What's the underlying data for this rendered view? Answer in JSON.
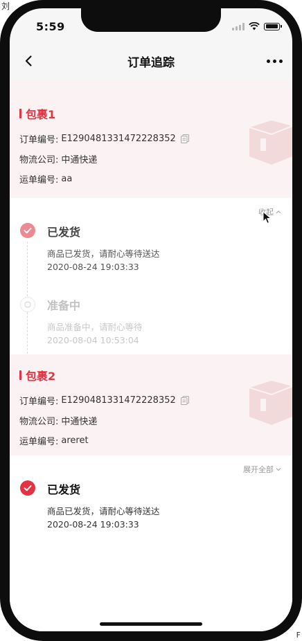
{
  "corner": {
    "top_left": "刘",
    "bottom_right": "F"
  },
  "status_bar": {
    "time": "5:59"
  },
  "nav": {
    "title": "订单追踪"
  },
  "packages": [
    {
      "title": "包裹1",
      "order_label": "订单编号:",
      "order_no": "E1290481331472228352",
      "carrier_label": "物流公司:",
      "carrier": "中通快递",
      "waybill_label": "运单编号:",
      "waybill": "aa",
      "toggle_label": "收起",
      "events": [
        {
          "status": "已发货",
          "desc": "商品已发货，请耐心等待送达",
          "time": "2020-08-24 19:03:33"
        },
        {
          "status": "准备中",
          "desc": "商品准备中，请耐心等待",
          "time": "2020-08-04 10:53:04"
        }
      ]
    },
    {
      "title": "包裹2",
      "order_label": "订单编号:",
      "order_no": "E1290481331472228352",
      "carrier_label": "物流公司:",
      "carrier": "中通快递",
      "waybill_label": "运单编号:",
      "waybill": "areret",
      "toggle_label": "展开全部",
      "events": [
        {
          "status": "已发货",
          "desc": "商品已发货，请耐心等待送达",
          "time": "2020-08-24 19:03:33"
        }
      ]
    }
  ],
  "colors": {
    "accent": "#e33343",
    "accent_faded": "#ec8a93",
    "muted": "#c4c4c4"
  },
  "icons": {
    "back": "chevron-left-icon",
    "more": "more-dots-icon",
    "copy": "copy-icon",
    "done": "check-circle-icon",
    "pending": "pending-circle-icon"
  }
}
